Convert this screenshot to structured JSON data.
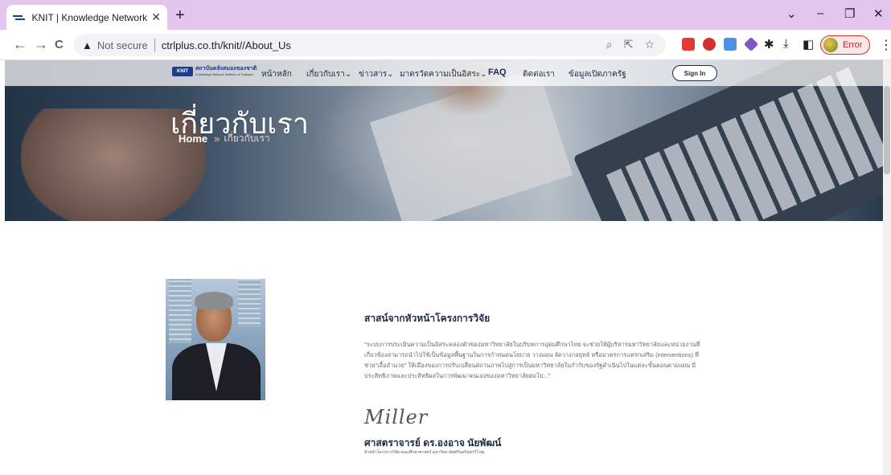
{
  "browser": {
    "tab_title": "KNIT | Knowledge Network Instit",
    "new_tab": "+",
    "url_warning": "Not secure",
    "url": "ctrlplus.co.th/knit//About_Us",
    "profile_status": "Error",
    "controls": {
      "minimize": "–",
      "maximize": "❐",
      "close": "✕",
      "dropdown": "⌄"
    },
    "nav": {
      "back": "←",
      "forward": "→",
      "reload": "C"
    },
    "kebab": "⋮"
  },
  "site": {
    "logo_mark": "KNIT",
    "logo_th": "สถาบันคลังสมองของชาติ",
    "logo_en": "Knowledge Network Institute of Thailand",
    "menu": [
      "หน้าหลัก",
      "เกี่ยวกับเรา",
      "ข่าวสาร",
      "มาตรวัดความเป็นอิสระ",
      "FAQ",
      "ติดต่อเรา",
      "ข้อมูลเปิดภาครัฐ"
    ],
    "menu_caret": "⌄",
    "signin": "Sign In",
    "hero_title": "เกี่ยวกับเรา",
    "breadcrumb": {
      "home": "Home",
      "separator": "»",
      "current": "เกี่ยวกับเรา"
    }
  },
  "content": {
    "heading": "สาสน์จากหัวหน้าโครงการวิจัย",
    "quote": "\"ระบบการประเมินความเป็นอิสระคล่องตัวของมหาวิทยาลัยในบริบทการอุดมศึกษาไทย จะช่วยให้ผู้บริหารมหาวิทยาลัยและหน่วยงานที่เกี่ยวข้องสามารถนำไปใช้เป็นข้อมูลพื้นฐานในการกำหนดนโยบาย วางแผน จัดวางกลยุทธ์ หรือมาตรการแทรกเสริม (interventions) ที่ช่วย\"เอื้ออำนวย\" ให้เมืองของการปรับเปลี่ยนสถานภาพไปสู่การเป็นมหาวิทยาลัยในกำกับของรัฐดำเนินไปในแต่ละขั้นตอนตามแผน มีประสิทธิภาพและประสิทธิผลในการพัฒนาตนเองของมหาวิทยาลัยต่อไป...\"",
    "signature_glyph": "Miller",
    "signer_name": "ศาสตราจารย์ ดร.องอาจ นัยพัฒน์",
    "signer_title": "หัวหน้าโครงการวิจัย คณะศึกษาศาสตร์ มหาวิทยาลัยศรีนครินทรวิโรฒ"
  }
}
